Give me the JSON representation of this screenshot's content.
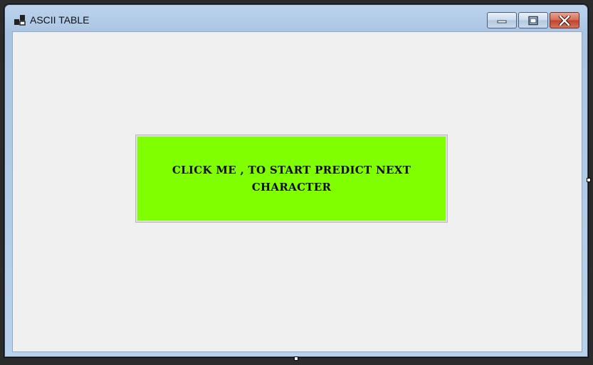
{
  "window": {
    "title": "ASCII TABLE",
    "icon": "app-window-icon"
  },
  "caption_buttons": {
    "minimize_icon": "minimize-icon",
    "maximize_icon": "maximize-icon",
    "close_icon": "close-icon"
  },
  "main": {
    "predict_button_label": "CLICK ME , TO START PREDICT NEXT CHARACTER",
    "predict_button_color": "#80ff00"
  },
  "designer": {
    "resize_handles": [
      "right",
      "bottom"
    ]
  }
}
